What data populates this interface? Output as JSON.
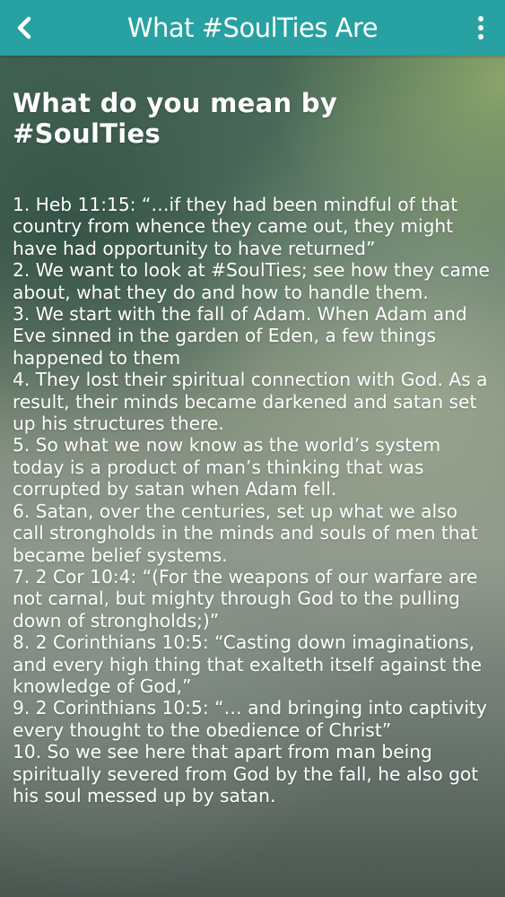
{
  "header": {
    "title": "What #SoulTies Are",
    "back_icon": "chevron-left-icon",
    "menu_icon": "more-vertical-icon",
    "background_color": "#27a1a2"
  },
  "article": {
    "heading": "What do you mean by #SoulTies",
    "items": [
      " 1. Heb 11:15: “…if they had been mindful of that country from whence they came out, they might have had opportunity to have returned”",
      " 2. We want to look at #SoulTies; see how they came about, what they do and how to handle them.",
      " 3. We start with the fall of Adam. When Adam and Eve sinned in the garden of Eden, a few things happened to them",
      " 4. They lost their spiritual connection with God. As a result, their minds became darkened and satan set up his structures there.",
      " 5. So what we now know as the world’s system today is a product of man’s thinking that was corrupted by satan when Adam fell.",
      " 6. Satan, over the centuries, set up what we also call strongholds in the minds and souls of men that became belief systems.",
      " 7. 2 Cor 10:4: “(For the weapons of our warfare are not carnal, but mighty through God to the pulling down of strongholds;)”",
      " 8. 2 Corinthians 10:5: “Casting down imaginations, and every high thing that exalteth itself against the knowledge of God,”",
      " 9. 2 Corinthians 10:5: “… and bringing into captivity every thought to the obedience of Christ”",
      " 10. So we see here that apart from man being spiritually severed from God by the fall, he also got his soul messed up by satan."
    ]
  }
}
